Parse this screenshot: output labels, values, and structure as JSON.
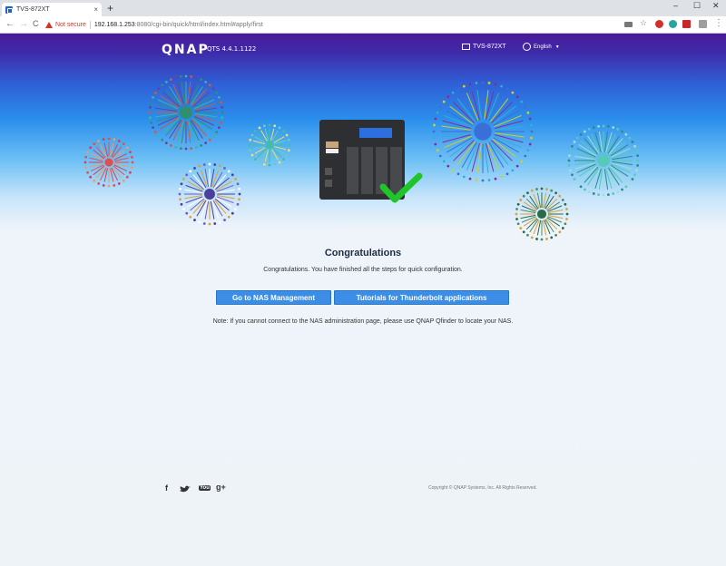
{
  "browser": {
    "tab_title": "TVS-872XT",
    "tab_close": "×",
    "new_tab": "+",
    "win_min": "–",
    "win_max": "☐",
    "win_close": "✕",
    "back": "←",
    "forward": "→",
    "reload": "C",
    "security_label": "Not secure",
    "url_host": "192.168.1.253",
    "url_rest": ":8080/cgi-bin/quick/html/index.html#apply/first",
    "menu": "⋮"
  },
  "header": {
    "brand": "QNAP",
    "version": "QTS 4.4.1.1122",
    "model": "TVS-872XT",
    "language": "English",
    "caret": "▼"
  },
  "main": {
    "title": "Congratulations",
    "subtitle": "Congratulations. You have finished all the steps for quick configuration.",
    "btn_nas": "Go to NAS Management",
    "btn_tutorials": "Tutorials for Thunderbolt applications",
    "note": "Note: If you cannot connect to the NAS administration page, please use QNAP Qfinder to locate your NAS."
  },
  "footer": {
    "facebook": "f",
    "youtube": "You",
    "gplus": "g+",
    "copyright": "Copyright © QNAP Systems, Inc. All Rights Reserved."
  },
  "colors": {
    "header_purple": "#4a1a9a",
    "sky_blue": "#2b8fec",
    "button_blue": "#3b8de5",
    "check_green": "#21c42a"
  }
}
